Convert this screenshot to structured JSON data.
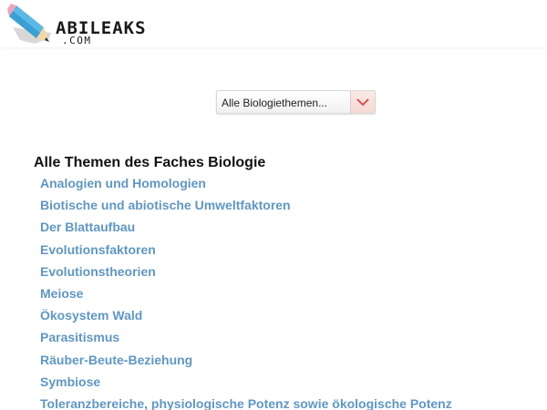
{
  "header": {
    "logo": {
      "name": "ABILEAKS",
      "sub": ".COM",
      "icon": "pencil-icon"
    }
  },
  "topic_select": {
    "selected_label": "Alle Biologiethemen...",
    "icon": "chevron-down-icon"
  },
  "section": {
    "title": "Alle Themen des Faches Biologie",
    "topics": [
      "Analogien und Homologien",
      "Biotische und abiotische Umweltfaktoren",
      "Der Blattaufbau",
      "Evolutionsfaktoren",
      "Evolutionstheorien",
      "Meiose",
      "Ökosystem Wald",
      "Parasitismus",
      "Räuber-Beute-Beziehung",
      "Symbiose",
      "Toleranzbereiche, physiologische Potenz sowie ökologische Potenz"
    ]
  },
  "colors": {
    "link": "#5f97c4",
    "heading": "#111111",
    "select_accent": "#d9534f",
    "pencil_blue": "#5bb9e6",
    "pencil_pink": "#f2a2b6"
  }
}
